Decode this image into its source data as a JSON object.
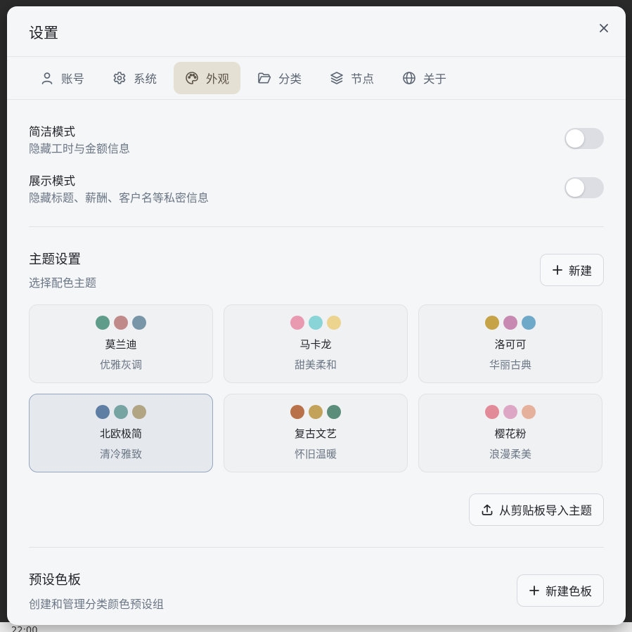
{
  "dialog": {
    "title": "设置"
  },
  "tabs": [
    {
      "label": "账号",
      "icon": "user-icon",
      "active": false
    },
    {
      "label": "系统",
      "icon": "gear-icon",
      "active": false
    },
    {
      "label": "外观",
      "icon": "palette-icon",
      "active": true
    },
    {
      "label": "分类",
      "icon": "folder-icon",
      "active": false
    },
    {
      "label": "节点",
      "icon": "layers-icon",
      "active": false
    },
    {
      "label": "关于",
      "icon": "globe-icon",
      "active": false
    }
  ],
  "simple_mode": {
    "title": "简洁模式",
    "desc": "隐藏工时与金额信息",
    "enabled": false
  },
  "present_mode": {
    "title": "展示模式",
    "desc": "隐藏标题、薪酬、客户名等私密信息",
    "enabled": false
  },
  "theme_section": {
    "title": "主题设置",
    "desc": "选择配色主题",
    "new_label": "新建"
  },
  "themes": [
    {
      "name": "莫兰迪",
      "sub": "优雅灰调",
      "colors": [
        "#5f9c89",
        "#c08a8b",
        "#7896a8"
      ],
      "selected": false
    },
    {
      "name": "马卡龙",
      "sub": "甜美柔和",
      "colors": [
        "#e99ab1",
        "#88d4d6",
        "#ecd48e"
      ],
      "selected": false
    },
    {
      "name": "洛可可",
      "sub": "华丽古典",
      "colors": [
        "#c6a346",
        "#c789b1",
        "#6ea9c9"
      ],
      "selected": false
    },
    {
      "name": "北欧极简",
      "sub": "清冷雅致",
      "colors": [
        "#5e7ea3",
        "#76a4a3",
        "#b1a584"
      ],
      "selected": true
    },
    {
      "name": "复古文艺",
      "sub": "怀旧温暖",
      "colors": [
        "#b87148",
        "#c3a25a",
        "#5a8e7b"
      ],
      "selected": false
    },
    {
      "name": "樱花粉",
      "sub": "浪漫柔美",
      "colors": [
        "#e38a98",
        "#dca6c4",
        "#e5b19c"
      ],
      "selected": false
    }
  ],
  "import_label": "从剪贴板导入主题",
  "palette_section": {
    "title": "预设色板",
    "desc": "创建和管理分类颜色预设组",
    "new_label": "新建色板"
  },
  "backdrop": {
    "time": "22:00"
  }
}
